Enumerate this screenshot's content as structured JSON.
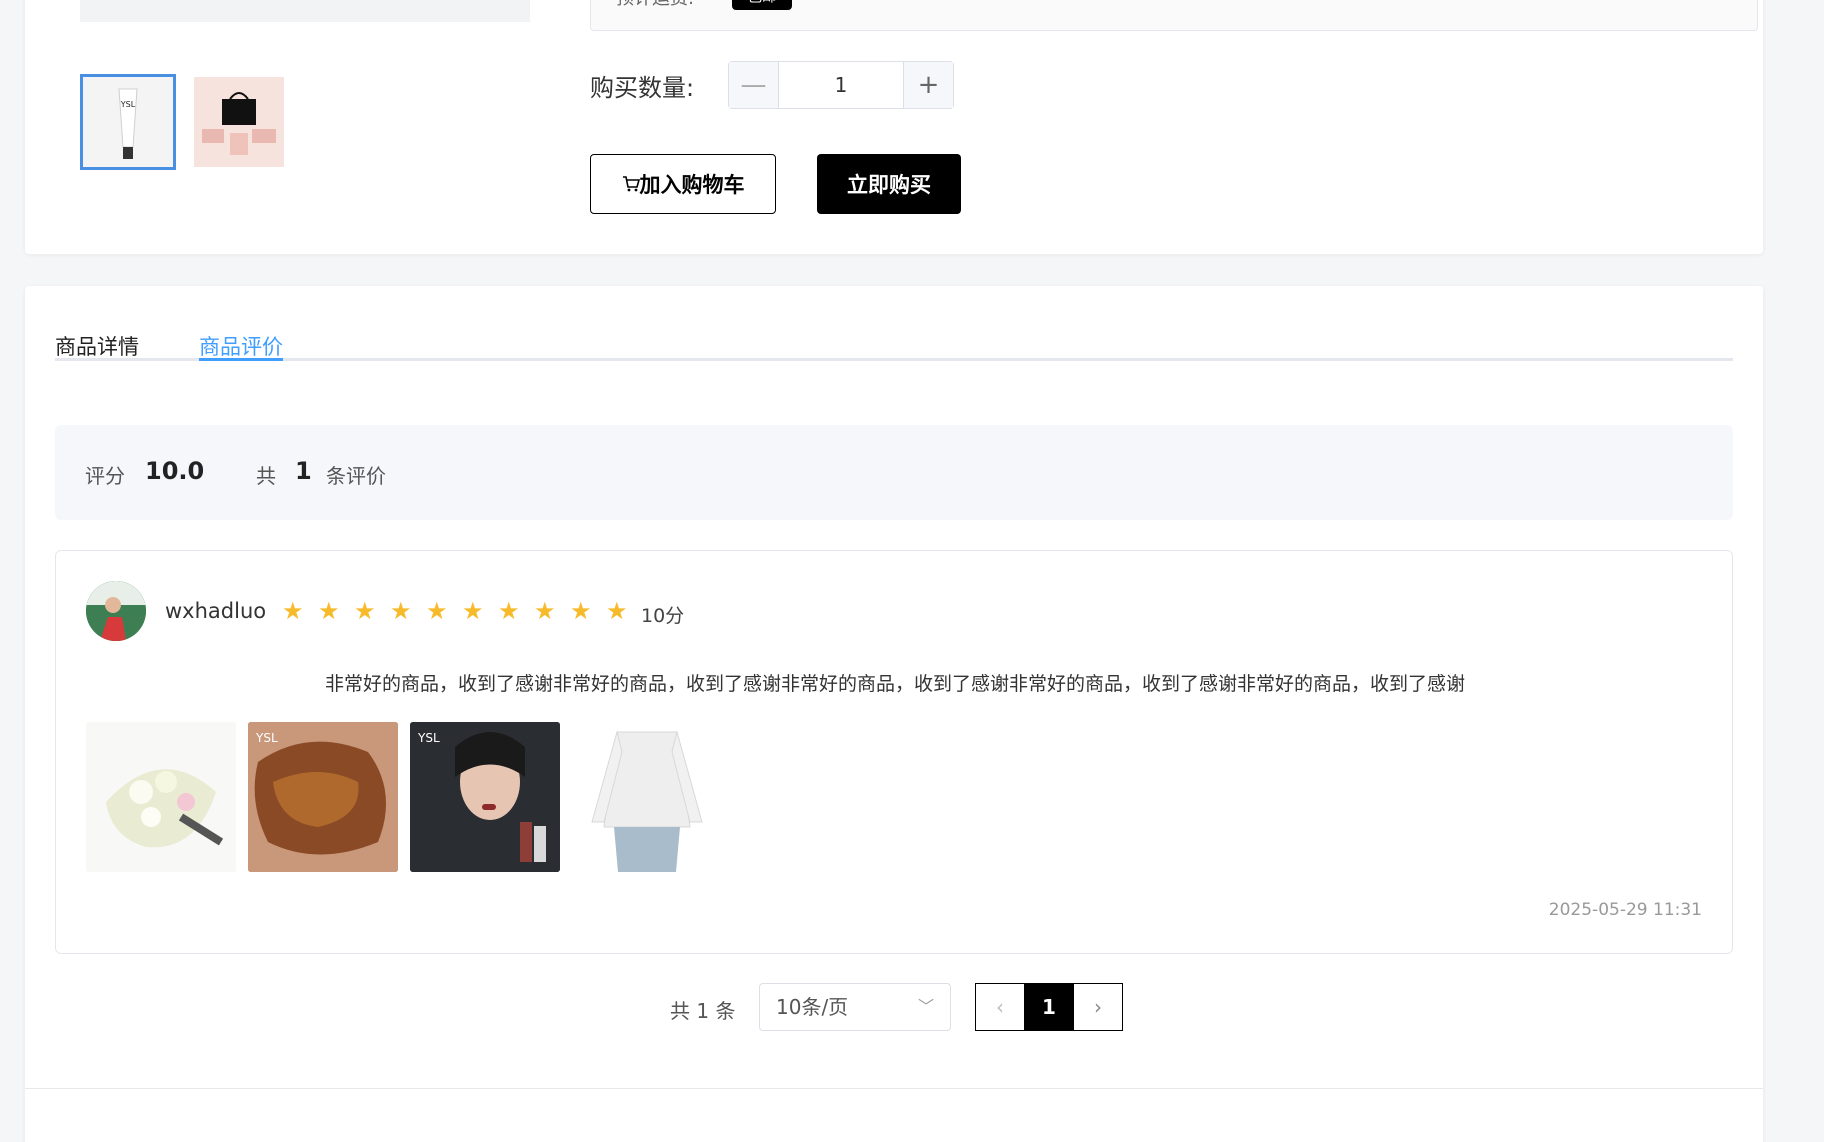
{
  "product": {
    "shipping_label": "预计运费:",
    "shipping_badge": "包邮",
    "qty_label": "购买数量:",
    "qty_value": "1",
    "minus_symbol": "—",
    "plus_symbol": "+",
    "add_cart_label": "加入购物车",
    "buy_now_label": "立即购买"
  },
  "tabs": [
    {
      "label": "商品详情",
      "active": false
    },
    {
      "label": "商品评价",
      "active": true
    }
  ],
  "summary": {
    "score_label": "评分",
    "score_value": "10.0",
    "total_prefix": "共",
    "total_count": "1",
    "total_suffix": "条评价"
  },
  "review": {
    "username": "wxhadluo",
    "stars": 10,
    "score_text": "10分",
    "comment": "非常好的商品，收到了感谢非常好的商品，收到了感谢非常好的商品，收到了感谢非常好的商品，收到了感谢非常好的商品，收到了感谢",
    "date": "2025-05-29 11:31"
  },
  "pagination": {
    "total_text": "共 1 条",
    "page_size": "10条/页",
    "current_page": "1"
  },
  "colors": {
    "accent": "#409eff",
    "star": "#f7ba2a",
    "primary_button": "#000000"
  }
}
